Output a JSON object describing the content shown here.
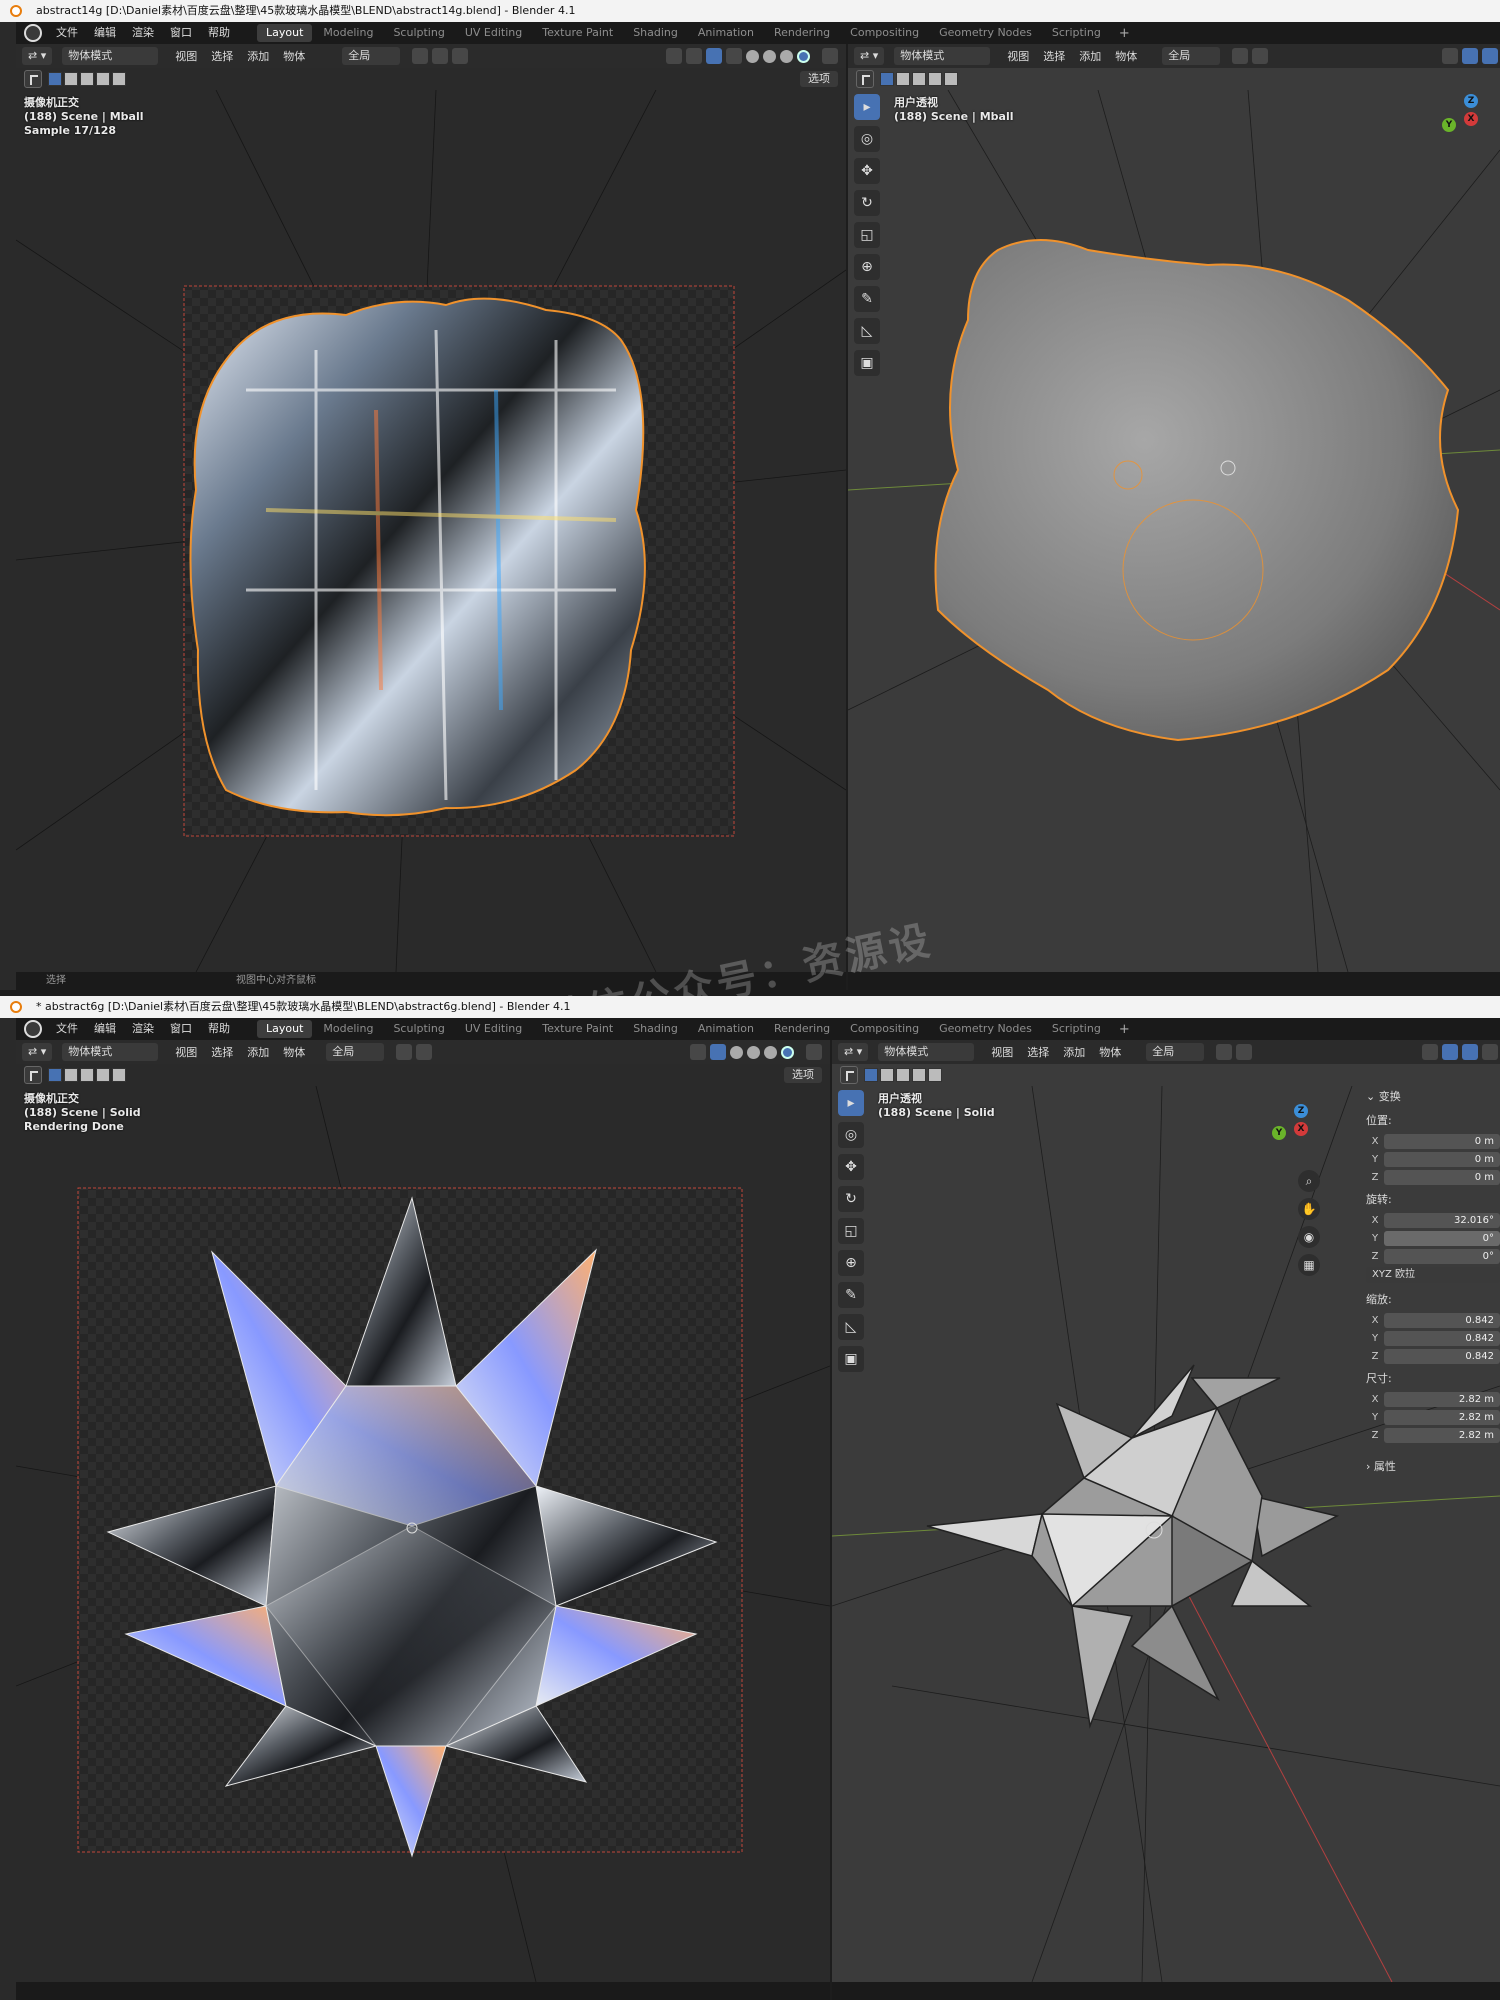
{
  "top": {
    "title": "abstract14g [D:\\Daniel素材\\百度云盘\\整理\\45款玻璃水晶模型\\BLEND\\abstract14g.blend] - Blender 4.1",
    "menus": [
      "文件",
      "编辑",
      "渲染",
      "窗口",
      "帮助"
    ],
    "workspaces": [
      "Layout",
      "Modeling",
      "Sculpting",
      "UV Editing",
      "Texture Paint",
      "Shading",
      "Animation",
      "Rendering",
      "Compositing",
      "Geometry Nodes",
      "Scripting",
      "+"
    ],
    "active_workspace": "Layout",
    "left_header": {
      "mode": "物体模式",
      "items": [
        "视图",
        "选择",
        "添加",
        "物体"
      ],
      "transform": "全局"
    },
    "right_header": {
      "mode": "物体模式",
      "items": [
        "视图",
        "选择",
        "添加",
        "物体"
      ],
      "transform": "全局"
    },
    "options_label": "选项",
    "left_overlay": [
      "摄像机正交",
      "(188) Scene | Mball",
      "Sample 17/128"
    ],
    "right_overlay": [
      "用户透视",
      "(188) Scene | Mball"
    ],
    "status": [
      "选择",
      "视图中心对齐鼠标"
    ]
  },
  "bottom": {
    "title": "* abstract6g [D:\\Daniel素材\\百度云盘\\整理\\45款玻璃水晶模型\\BLEND\\abstract6g.blend] - Blender 4.1",
    "menus": [
      "文件",
      "编辑",
      "渲染",
      "窗口",
      "帮助"
    ],
    "workspaces": [
      "Layout",
      "Modeling",
      "Sculpting",
      "UV Editing",
      "Texture Paint",
      "Shading",
      "Animation",
      "Rendering",
      "Compositing",
      "Geometry Nodes",
      "Scripting",
      "+"
    ],
    "active_workspace": "Layout",
    "left_header": {
      "mode": "物体模式",
      "items": [
        "视图",
        "选择",
        "添加",
        "物体"
      ],
      "transform": "全局"
    },
    "right_header": {
      "mode": "物体模式",
      "items": [
        "视图",
        "选择",
        "添加",
        "物体"
      ],
      "transform": "全局"
    },
    "options_label": "选项",
    "left_overlay": [
      "摄像机正交",
      "(188) Scene | Solid",
      "Rendering Done"
    ],
    "right_overlay": [
      "用户透视",
      "(188) Scene | Solid"
    ],
    "npanel": {
      "transform_header": "变换",
      "location_label": "位置:",
      "location": [
        {
          "axis": "X",
          "value": "0 m"
        },
        {
          "axis": "Y",
          "value": "0 m"
        },
        {
          "axis": "Z",
          "value": "0 m"
        }
      ],
      "rotation_label": "旋转:",
      "rotation": [
        {
          "axis": "X",
          "value": "32.016°"
        },
        {
          "axis": "Y",
          "value": "0°"
        },
        {
          "axis": "Z",
          "value": "0°"
        }
      ],
      "rotation_mode": "XYZ 欧拉",
      "scale_label": "缩放:",
      "scale": [
        {
          "axis": "X",
          "value": "0.842"
        },
        {
          "axis": "Y",
          "value": "0.842"
        },
        {
          "axis": "Z",
          "value": "0.842"
        }
      ],
      "dimensions_label": "尺寸:",
      "dimensions": [
        {
          "axis": "X",
          "value": "2.82 m"
        },
        {
          "axis": "Y",
          "value": "2.82 m"
        },
        {
          "axis": "Z",
          "value": "2.82 m"
        }
      ],
      "properties_header": "属性"
    }
  },
  "watermark": "微信公众号：资源设",
  "colors": {
    "accent": "#4772b3",
    "selection": "#f0922c",
    "bg": "#1d1d1d",
    "viewport": "#3d3d3d"
  }
}
